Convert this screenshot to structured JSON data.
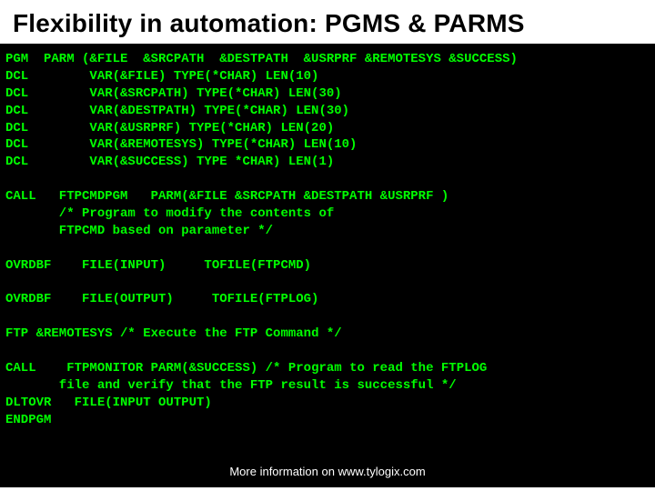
{
  "title": "Flexibility in automation: PGMS & PARMS",
  "code": {
    "l1": "PGM  PARM (&FILE  &SRCPATH  &DESTPATH  &USRPRF &REMOTESYS &SUCCESS)",
    "l2": "DCL        VAR(&FILE) TYPE(*CHAR) LEN(10)",
    "l3": "DCL        VAR(&SRCPATH) TYPE(*CHAR) LEN(30)",
    "l4": "DCL        VAR(&DESTPATH) TYPE(*CHAR) LEN(30)",
    "l5": "DCL        VAR(&USRPRF) TYPE(*CHAR) LEN(20)",
    "l6": "DCL        VAR(&REMOTESYS) TYPE(*CHAR) LEN(10)",
    "l7": "DCL        VAR(&SUCCESS) TYPE *CHAR) LEN(1)",
    "l8": "",
    "l9a": "CALL   FTPCMDPGM   PARM(&FILE &SRCPATH &DESTPATH &USRPRF )",
    "l9b": "       /* Program to modify the contents of",
    "l9c": "       FTPCMD based on parameter */",
    "l10": "",
    "l11": "OVRDBF    FILE(INPUT)     TOFILE(FTPCMD)",
    "l12": "",
    "l13": "OVRDBF    FILE(OUTPUT)     TOFILE(FTPLOG)",
    "l14": "",
    "l15a": "FTP &REMOTESYS ",
    "l15b": "/* Execute the FTP Command */",
    "l16": "",
    "l17a": "CALL    FTPMONITOR PARM(&SUCCESS) ",
    "l17b": "/* Program to read the FTPLOG",
    "l17c": "       file and verify that the FTP result is successful */",
    "l18": "DLTOVR   FILE(INPUT OUTPUT)",
    "l19": "ENDPGM"
  },
  "footer": "More information on www.tylogix.com"
}
